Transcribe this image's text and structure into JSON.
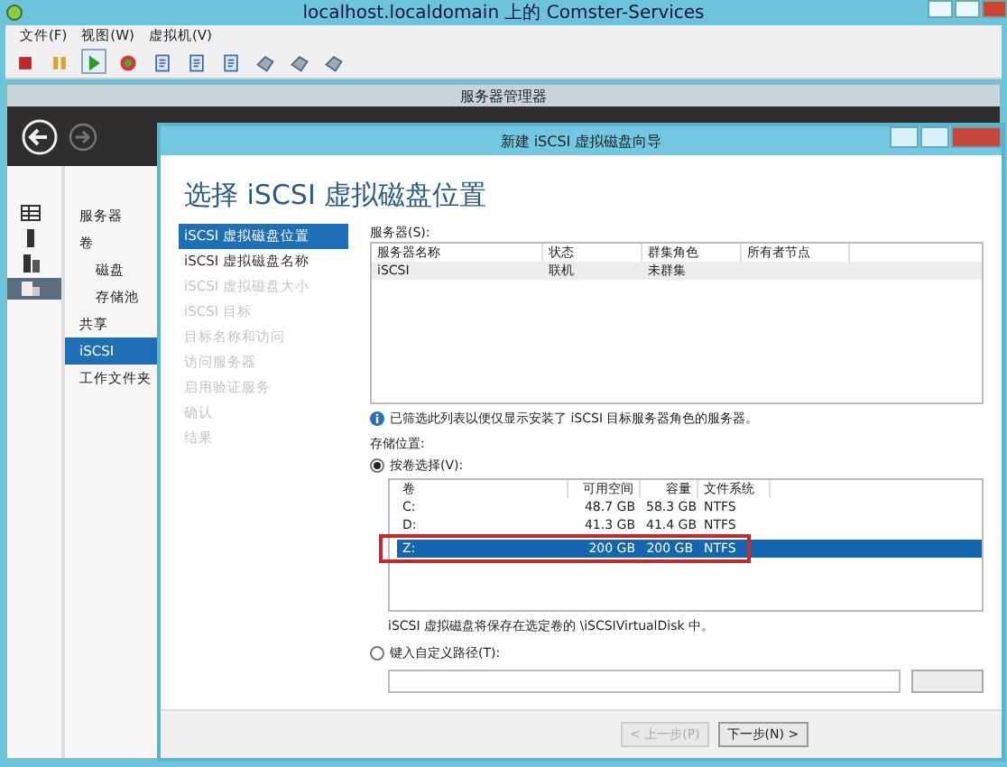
{
  "window": {
    "title": "localhost.localdomain 上的 Comster-Services"
  },
  "menu": [
    "文件(F)",
    "视图(W)",
    "虚拟机(V)"
  ],
  "toolbar": [
    {
      "kind": "stop",
      "selected": false
    },
    {
      "kind": "pause",
      "selected": false
    },
    {
      "kind": "play",
      "selected": true
    },
    {
      "kind": "reset",
      "selected": false
    },
    {
      "kind": "page",
      "selected": false
    },
    {
      "kind": "page",
      "selected": false
    },
    {
      "kind": "page",
      "selected": false
    },
    {
      "kind": "tool",
      "selected": false
    },
    {
      "kind": "tool",
      "selected": false
    },
    {
      "kind": "tool",
      "selected": false
    }
  ],
  "server_manager": {
    "title": "服务器管理器",
    "rail": [
      {
        "kind": "grid",
        "selected": false
      },
      {
        "kind": "server",
        "selected": false
      },
      {
        "kind": "servers",
        "selected": false
      },
      {
        "kind": "storage",
        "selected": true
      }
    ],
    "nav": [
      {
        "label": "服务器",
        "selected": false
      },
      {
        "label": "卷",
        "selected": false,
        "children": [
          {
            "label": "磁盘",
            "selected": false
          },
          {
            "label": "存储池",
            "selected": false
          }
        ]
      },
      {
        "label": "共享",
        "selected": false
      },
      {
        "label": "iSCSI",
        "selected": true
      },
      {
        "label": "工作文件夹",
        "selected": false
      }
    ]
  },
  "dialog": {
    "title": "新建 iSCSI 虚拟磁盘向导",
    "heading": "选择 iSCSI 虚拟磁盘位置",
    "steps": [
      {
        "label": "iSCSI 虚拟磁盘位置",
        "selected": true,
        "disabled": false
      },
      {
        "label": "iSCSI 虚拟磁盘名称",
        "selected": false,
        "disabled": false
      },
      {
        "label": "iSCSI 虚拟磁盘大小",
        "selected": false,
        "disabled": true
      },
      {
        "label": "iSCSI 目标",
        "selected": false,
        "disabled": true
      },
      {
        "label": "目标名称和访问",
        "selected": false,
        "disabled": true
      },
      {
        "label": "访问服务器",
        "selected": false,
        "disabled": true
      },
      {
        "label": "启用验证服务",
        "selected": false,
        "disabled": true
      },
      {
        "label": "确认",
        "selected": false,
        "disabled": true
      },
      {
        "label": "结果",
        "selected": false,
        "disabled": true
      }
    ],
    "servers": {
      "label": "服务器(S):",
      "columns": [
        "服务器名称",
        "状态",
        "群集角色",
        "所有者节点"
      ],
      "rows": [
        {
          "cells": [
            "iSCSI",
            "联机",
            "未群集"
          ],
          "selected": true
        }
      ]
    },
    "info": "已筛选此列表以便仅显示安装了 iSCSI 目标服务器角色的服务器。",
    "storage_label": "存储位置:",
    "options": [
      {
        "label": "按卷选择(V):",
        "selected": true
      },
      {
        "label": "键入自定义路径(T):",
        "selected": false
      }
    ],
    "volumes": {
      "columns": [
        "卷",
        "可用空间",
        "容量",
        "文件系统"
      ],
      "rows": [
        {
          "cells": [
            "C:",
            "48.7 GB",
            "58.3 GB",
            "NTFS"
          ],
          "selected": false,
          "highlighted": false
        },
        {
          "cells": [
            "D:",
            "41.3 GB",
            "41.4 GB",
            "NTFS"
          ],
          "selected": false,
          "highlighted": false
        },
        {
          "cells": [
            "Z:",
            "200 GB",
            "200 GB",
            "NTFS"
          ],
          "selected": true,
          "highlighted": true
        }
      ]
    },
    "note": "iSCSI 虚拟磁盘将保存在选定卷的 \\iSCSIVirtualDisk 中。",
    "buttons": [
      {
        "label": "< 上一步(P)",
        "disabled": true
      },
      {
        "label": "下一步(N) >",
        "disabled": false
      }
    ]
  }
}
